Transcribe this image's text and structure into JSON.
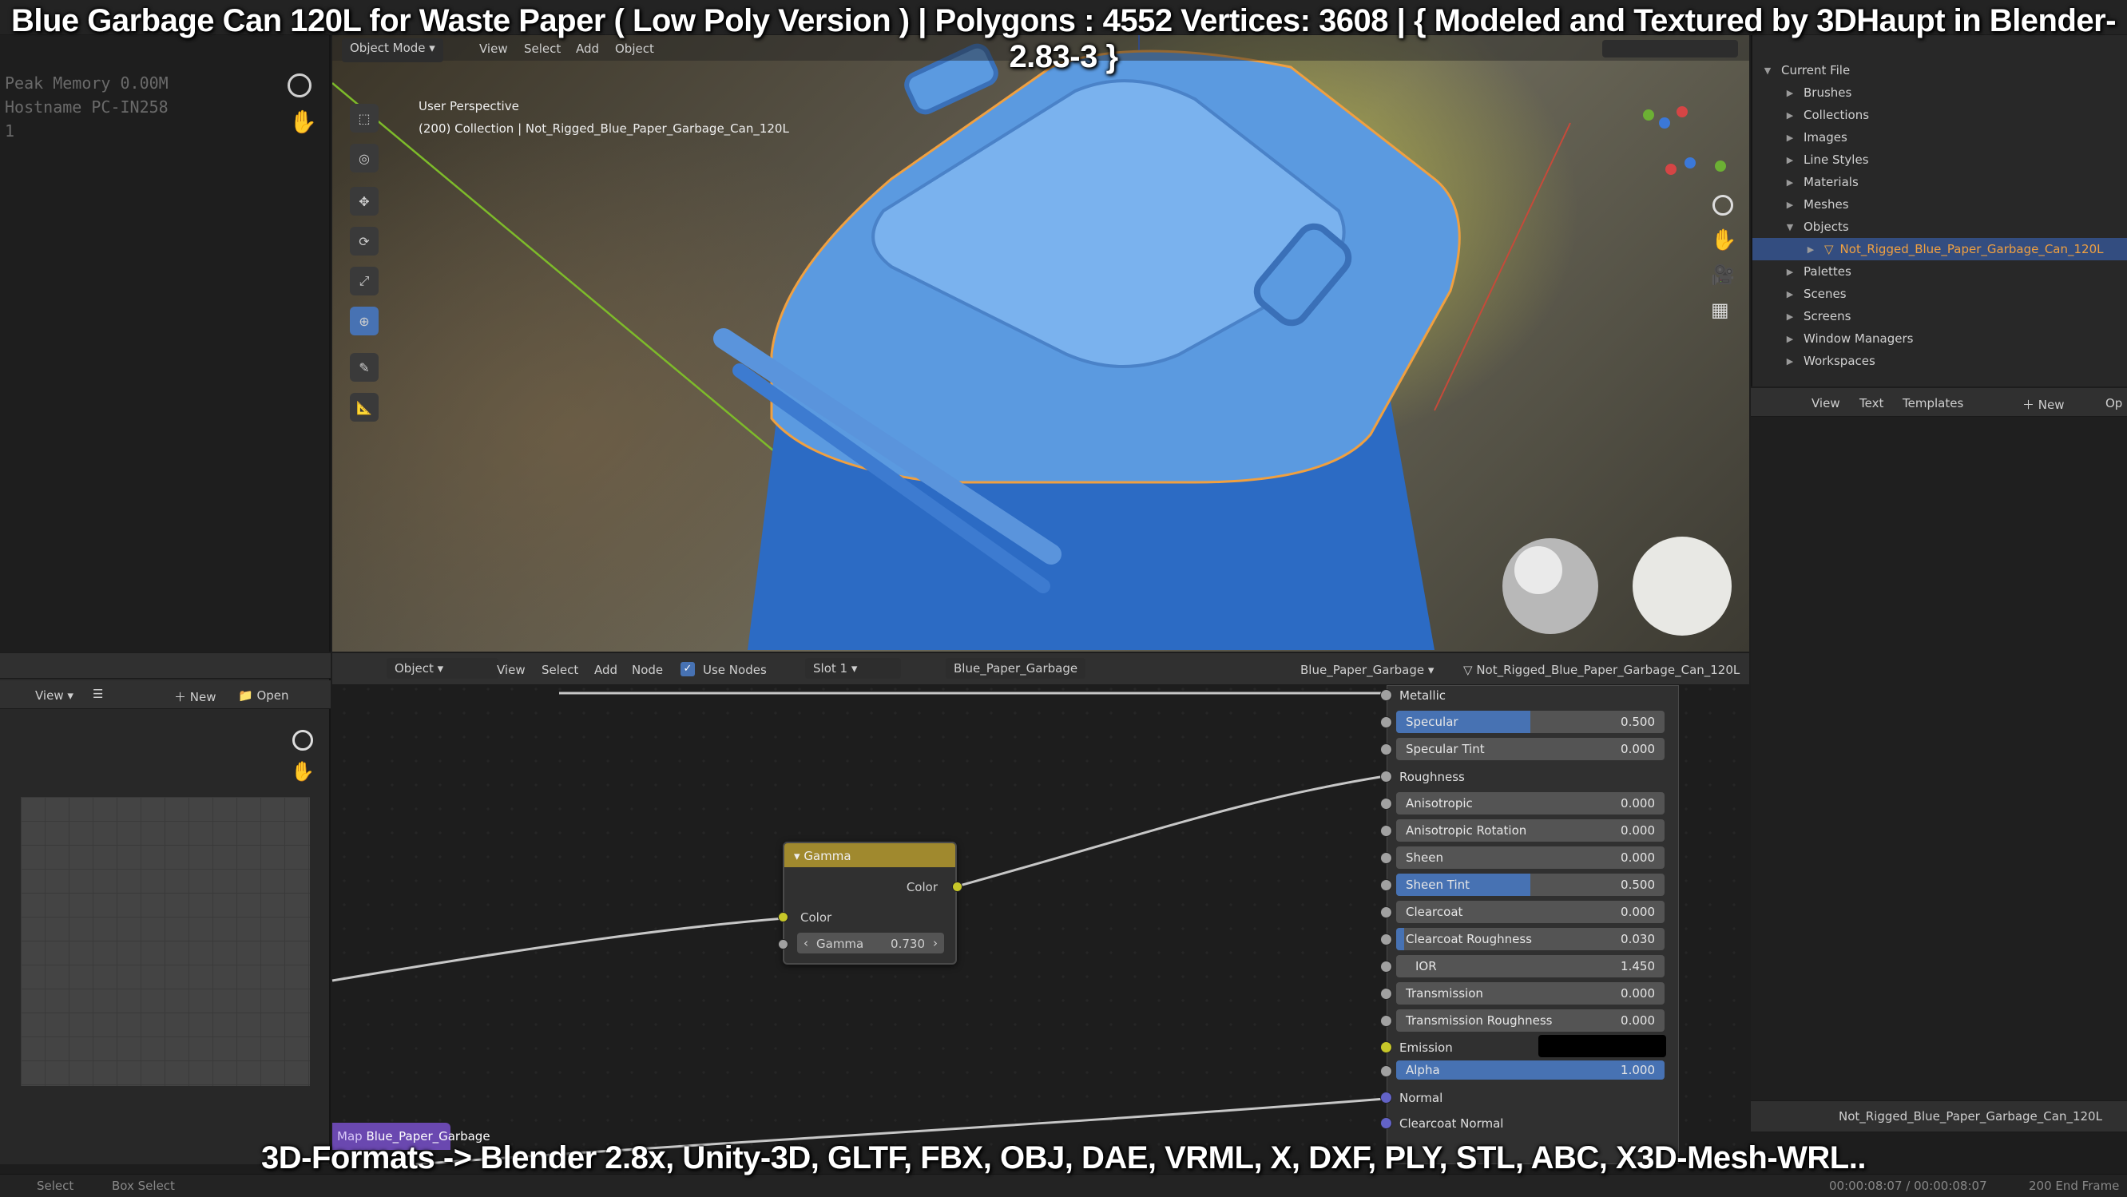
{
  "banner_top": "Blue Garbage Can 120L for Waste Paper ( Low Poly Version ) |  Polygons : 4552  Vertices: 3608   |   { Modeled and Textured by 3DHaupt in Blender-2.83-3 }",
  "banner_bottom": "3D-Formats -> Blender 2.8x, Unity-3D, GLTF, FBX, OBJ, DAE, VRML, X, DXF, PLY, STL, ABC, X3D-Mesh-WRL..",
  "info_panel": {
    "line1": "Peak Memory 0.00M",
    "line2": "Hostname PC-IN258",
    "line3": "1"
  },
  "viewport": {
    "mode": "Object Mode",
    "menu": [
      "View",
      "Select",
      "Add",
      "Object"
    ],
    "perspective": "User Perspective",
    "collection": "(200) Collection | Not_Rigged_Blue_Paper_Garbage_Can_120L"
  },
  "outliner": {
    "root": "Current File",
    "items": [
      "Brushes",
      "Collections",
      "Images",
      "Line Styles",
      "Materials",
      "Meshes",
      "Objects"
    ],
    "selected": "Not_Rigged_Blue_Paper_Garbage_Can_120L",
    "items2": [
      "Palettes",
      "Scenes",
      "Screens",
      "Window Managers",
      "Workspaces"
    ]
  },
  "text_editor": {
    "menu": [
      "View",
      "Text",
      "Templates"
    ],
    "new": "New",
    "open": "Op"
  },
  "image_editor": {
    "view": "View",
    "new": "New",
    "open": "Open"
  },
  "node_editor": {
    "object": "Object",
    "menu": [
      "View",
      "Select",
      "Add",
      "Node"
    ],
    "use_nodes": "Use Nodes",
    "slot": "Slot 1",
    "material": "Blue_Paper_Garbage",
    "material2": "Blue_Paper_Garbage",
    "object_name": "Not_Rigged_Blue_Paper_Garbage_Can_120L"
  },
  "gamma_node": {
    "title": "Gamma",
    "out": "Color",
    "in": "Color",
    "param": "Gamma",
    "value": "0.730"
  },
  "image_node_label": "Blue_Paper_Garbage",
  "image_node_prefix": "Map",
  "bsdf": {
    "metallic": "Metallic",
    "specular": {
      "label": "Specular",
      "value": "0.500",
      "fill": 0.5
    },
    "specular_tint": {
      "label": "Specular Tint",
      "value": "0.000"
    },
    "roughness": "Roughness",
    "anisotropic": {
      "label": "Anisotropic",
      "value": "0.000"
    },
    "anisotropic_rotation": {
      "label": "Anisotropic Rotation",
      "value": "0.000"
    },
    "sheen": {
      "label": "Sheen",
      "value": "0.000"
    },
    "sheen_tint": {
      "label": "Sheen Tint",
      "value": "0.500",
      "fill": 0.5
    },
    "clearcoat": {
      "label": "Clearcoat",
      "value": "0.000"
    },
    "clearcoat_roughness": {
      "label": "Clearcoat Roughness",
      "value": "0.030",
      "fill": 0.03
    },
    "ior": {
      "label": "IOR",
      "value": "1.450"
    },
    "transmission": {
      "label": "Transmission",
      "value": "0.000"
    },
    "transmission_roughness": {
      "label": "Transmission Roughness",
      "value": "0.000"
    },
    "emission": "Emission",
    "alpha": {
      "label": "Alpha",
      "value": "1.000",
      "fill": 1.0
    },
    "normal": "Normal",
    "clearcoat_normal": "Clearcoat Normal"
  },
  "properties_footer": "Not_Rigged_Blue_Paper_Garbage_Can_120L",
  "statusbar": {
    "select": "Select",
    "box_select": "Box Select",
    "time": "00:00:08:07 / 00:00:08:07",
    "end": "200 End Frame"
  }
}
